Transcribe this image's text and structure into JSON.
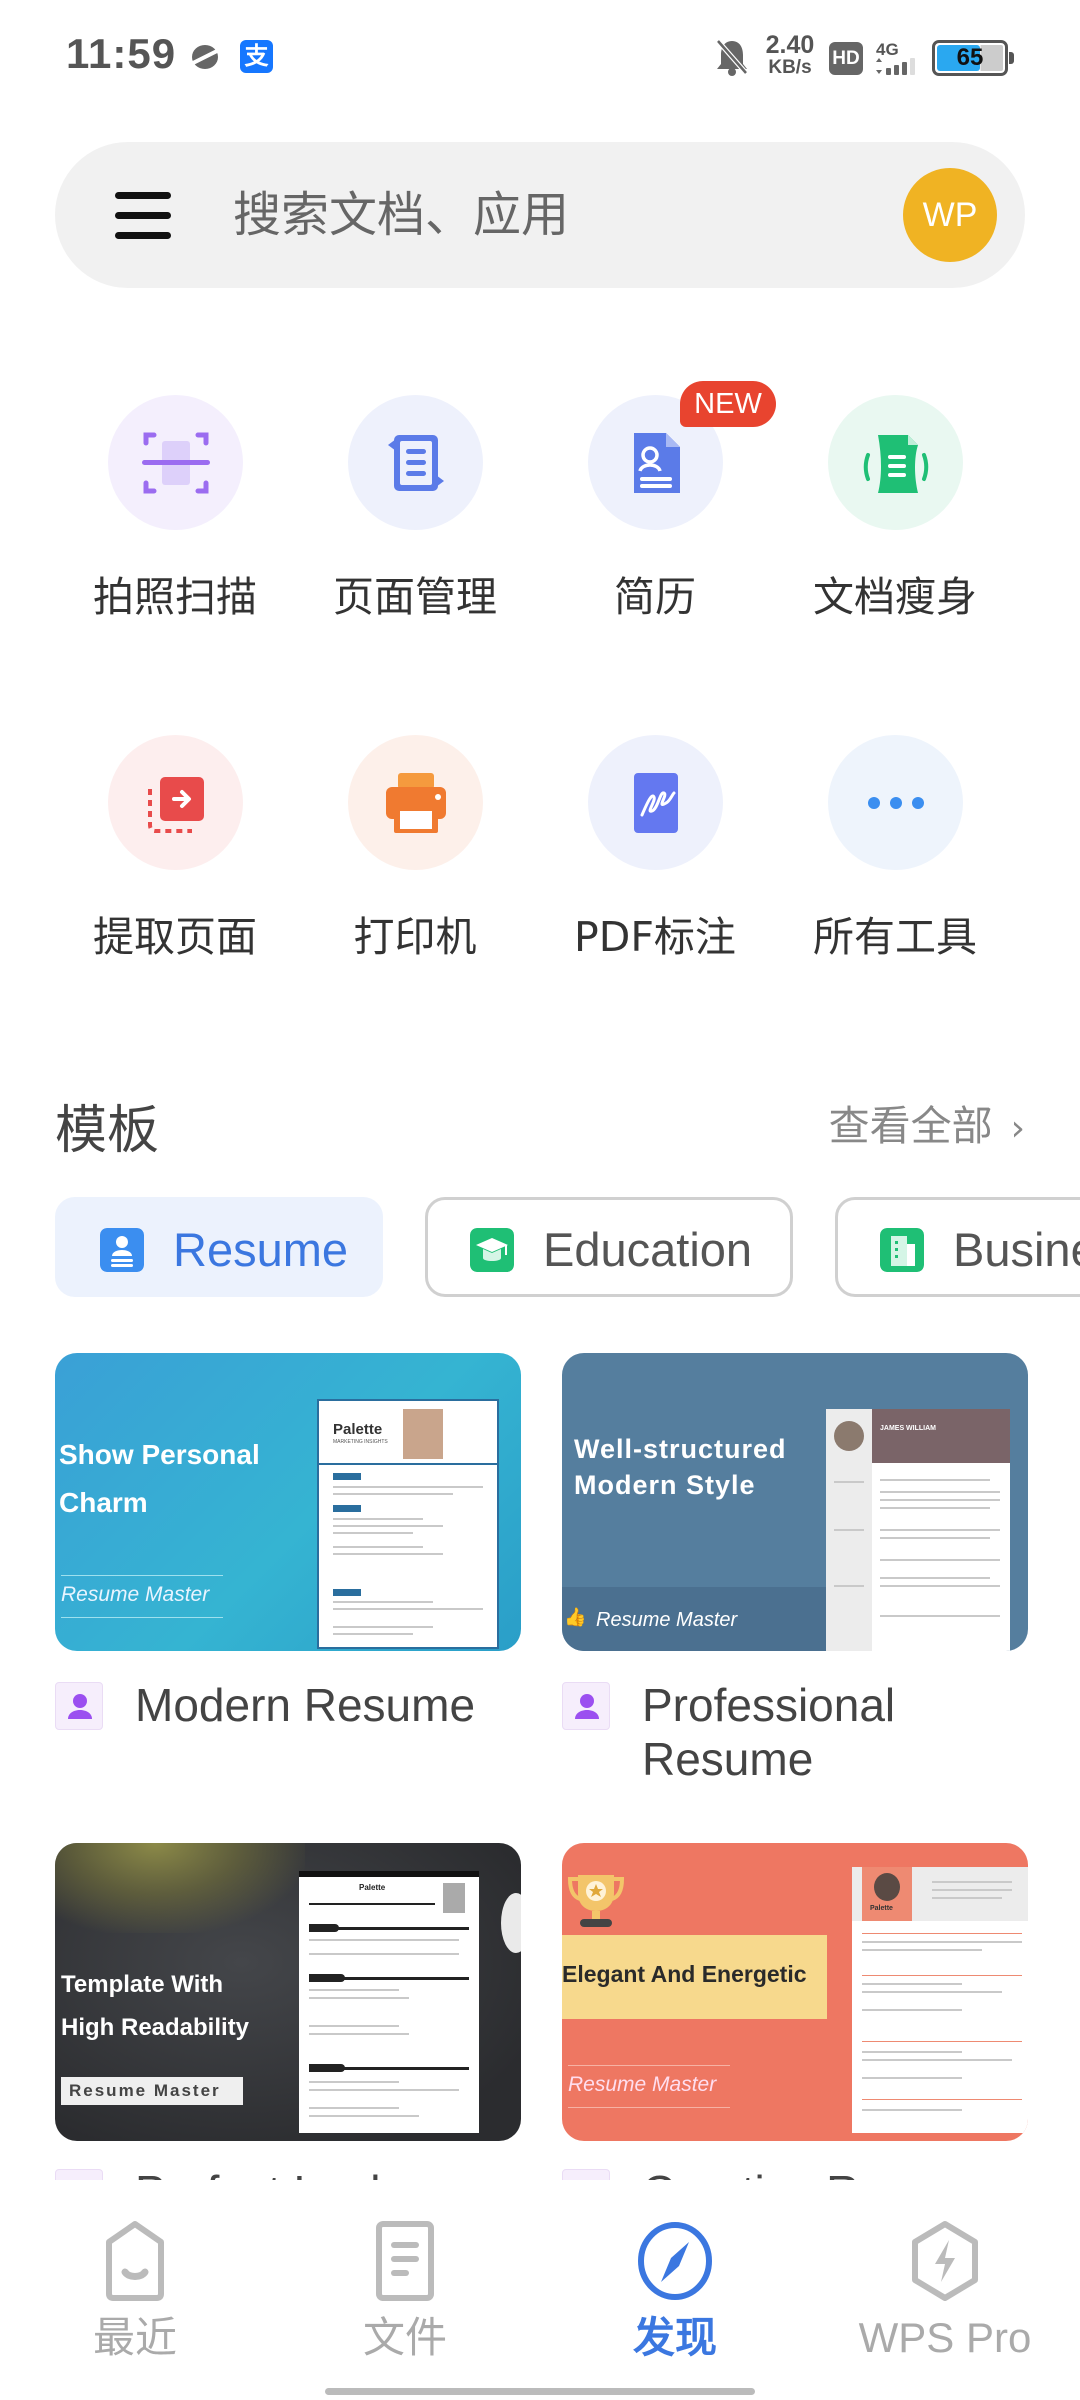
{
  "status_bar": {
    "time": "11:59",
    "net_speed_value": "2.40",
    "net_speed_unit": "KB/s",
    "hd_label": "HD",
    "network_label": "4G",
    "battery_percent": "65",
    "battery_level": 0.65,
    "app_icons": [
      "browser-planet-icon",
      "alipay-icon"
    ],
    "alipay_glyph": "支"
  },
  "search": {
    "placeholder": "搜索文档、应用",
    "avatar_initials": "WP",
    "avatar_color": "#f0b323"
  },
  "tools": [
    {
      "label": "拍照扫描",
      "icon": "scan-icon",
      "color": "#9b6cf0",
      "bg": "#f4effd"
    },
    {
      "label": "页面管理",
      "icon": "page-manage-icon",
      "color": "#5b7be8",
      "bg": "#eef1fc"
    },
    {
      "label": "简历",
      "icon": "resume-icon",
      "color": "#5b7be8",
      "bg": "#eef1fc",
      "badge": "NEW"
    },
    {
      "label": "文档瘦身",
      "icon": "doc-slim-icon",
      "color": "#1fbf75",
      "bg": "#e9f8f1"
    },
    {
      "label": "提取页面",
      "icon": "extract-page-icon",
      "color": "#e84b4b",
      "bg": "#fdeeee"
    },
    {
      "label": "打印机",
      "icon": "printer-icon",
      "color": "#f07a30",
      "bg": "#fdf0ea"
    },
    {
      "label": "PDF标注",
      "icon": "pdf-annotate-icon",
      "color": "#6478f0",
      "bg": "#eef1fc"
    },
    {
      "label": "所有工具",
      "icon": "more-tools-icon",
      "color": "#3b8ef0",
      "bg": "#eef4fc"
    }
  ],
  "templates": {
    "title": "模板",
    "view_all": "查看全部",
    "categories": [
      {
        "label": "Resume",
        "active": true,
        "icon": "resume-category-icon",
        "color": "#3b8ef0"
      },
      {
        "label": "Education",
        "active": false,
        "icon": "education-category-icon",
        "color": "#1fbf75"
      },
      {
        "label": "Business",
        "active": false,
        "icon": "business-category-icon",
        "color": "#1fbf75"
      }
    ],
    "cards": [
      {
        "headline_line1": "Show Personal",
        "headline_line2": "Charm",
        "brand": "Resume Master",
        "doc_name": "Palette",
        "doc_subtitle": "MARKETING INSIGHTS",
        "name": "Modern Resume"
      },
      {
        "headline_line1": "Well-structured",
        "headline_line2": "Modern Style",
        "brand": "Resume Master",
        "doc_name": "JAMES WILLIAM",
        "name": "Professional Resume"
      },
      {
        "headline_line1": "Template With",
        "headline_line2": "High Readability",
        "brand": "Resume Master",
        "doc_name": "Palette",
        "name": "Perfect Look"
      },
      {
        "headline_line1": "Elegant And Energetic",
        "headline_line2": "",
        "brand": "Resume Master",
        "doc_name": "Palette",
        "name": "Creative Resume"
      }
    ]
  },
  "bottom_nav": [
    {
      "label": "最近",
      "icon": "recent-icon",
      "active": false
    },
    {
      "label": "文件",
      "icon": "files-icon",
      "active": false
    },
    {
      "label": "发现",
      "icon": "discover-compass-icon",
      "active": true
    },
    {
      "label": "WPS Pro",
      "icon": "wps-pro-icon",
      "active": false
    }
  ]
}
